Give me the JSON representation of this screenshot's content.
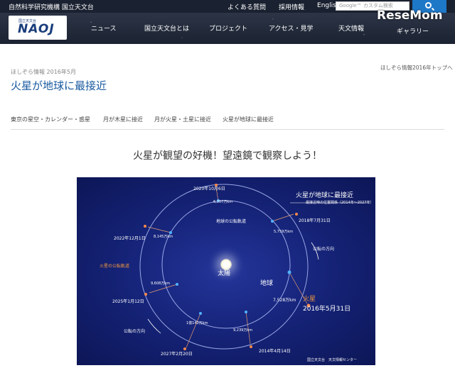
{
  "topbar": {
    "org": "自然科学研究機構 国立天文台",
    "links": [
      "よくある質問",
      "採用情報",
      "English"
    ],
    "search_placeholder": "Google™ カスタム検索"
  },
  "logo": {
    "small": "国立天文台",
    "big": "NAOJ"
  },
  "nav": {
    "items": [
      "ニュース",
      "国立天文台とは",
      "プロジェクト",
      "アクセス・見学",
      "天文情報",
      "ギャラリー"
    ]
  },
  "watermark": "ReseMom",
  "breadcrumb": "ほしぞら情報 2016年5月",
  "top_link": "ほしぞら情報2016年トップへ",
  "page_title": "火星が地球に最接近",
  "subnav": [
    "東京の星空・カレンダー・惑星",
    "月が木星に接近",
    "月が火星・土星に接近",
    "火星が地球に最接近"
  ],
  "headline": "火星が観望の好機！望遠鏡で観察しよう！",
  "figure": {
    "title": "火星が地球に最接近",
    "subtitle": "最接近時の位置関係（2014年〜2027年）",
    "sun": "太陽",
    "earth": "地球",
    "mars": "火星",
    "mars_date": "2016年5月31日",
    "earth_orbit": "地球の公転軌道",
    "mars_orbit": "火星の公転軌道",
    "revolution_1": "公転の方向",
    "revolution_2": "公転の方向",
    "credit": "国立天文台　天文情報センター",
    "approaches": [
      {
        "date": "2020年10月6日",
        "distance": "6,207万km"
      },
      {
        "date": "2018年7月31日",
        "distance": "5,759万km"
      },
      {
        "date": "2022年12月1日",
        "distance": "8,145万km"
      },
      {
        "date": "2025年1月12日",
        "distance": "9,608万km"
      },
      {
        "date": "2027年2月20日",
        "distance": "1億142万km"
      },
      {
        "date": "2014年4月14日",
        "distance": "9,239万km"
      },
      {
        "date": "2016年5月31日",
        "distance": "7,528万km"
      }
    ]
  }
}
